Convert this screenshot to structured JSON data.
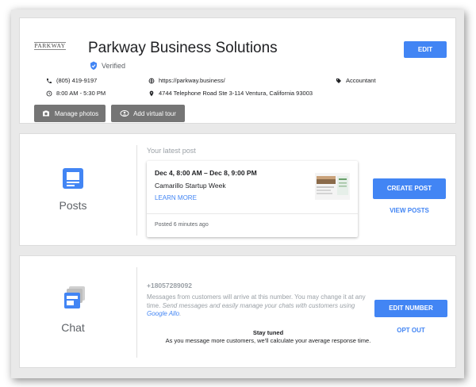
{
  "business": {
    "logo_text": "PARKWAY",
    "name": "Parkway Business Solutions",
    "verified_label": "Verified",
    "edit_label": "EDIT",
    "phone": "(805) 419-9197",
    "hours": "8:00 AM - 5:30 PM",
    "website": "https://parkway.business/",
    "address": "4744 Telephone Road Ste 3-114 Ventura, California 93003",
    "category": "Accountant",
    "manage_photos_label": "Manage photos",
    "virtual_tour_label": "Add virtual tour"
  },
  "posts": {
    "section_label": "Posts",
    "latest_label": "Your latest post",
    "post": {
      "date_range": "Dec 4, 8:00 AM – Dec 8, 9:00 PM",
      "title": "Camarillo Startup Week",
      "learn_more": "LEARN MORE",
      "posted": "Posted 6 minutes ago"
    },
    "create_label": "CREATE POST",
    "view_label": "VIEW POSTS"
  },
  "chat": {
    "section_label": "Chat",
    "phone": "+18057289092",
    "desc_normal": "Messages from customers will arrive at this number. You may change it at any time. ",
    "desc_italic": "Send messages and easily manage your chats with customers using ",
    "desc_link": "Google Allo",
    "desc_end": ".",
    "stay_title": "Stay tuned",
    "stay_desc": "As you message more customers, we'll calculate your average response time.",
    "edit_number_label": "EDIT NUMBER",
    "opt_out_label": "OPT OUT"
  },
  "colors": {
    "accent": "#4285f4",
    "gray_button": "#757575",
    "verified_badge": "#4285f4"
  },
  "icons": [
    "phone-icon",
    "clock-icon",
    "globe-icon",
    "location-pin-icon",
    "tag-icon",
    "camera-icon",
    "360-tour-icon",
    "verified-badge-icon",
    "posts-icon",
    "chat-icon"
  ]
}
